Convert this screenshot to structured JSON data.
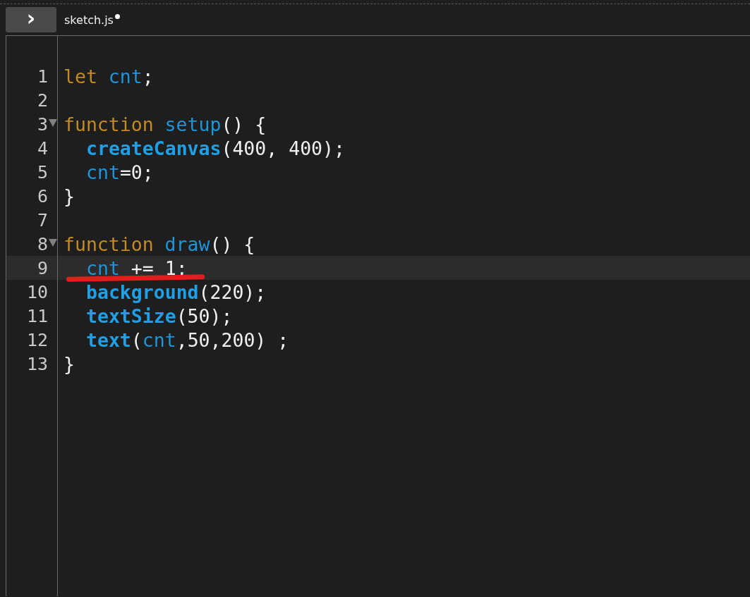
{
  "toolbar": {
    "toggle_button": {
      "label": "›"
    }
  },
  "tab": {
    "label": "sketch.js",
    "modified": true
  },
  "editor": {
    "lines": [
      {
        "number": "1",
        "fold": false,
        "current": false,
        "underlined": false,
        "indented": false,
        "tokens": [
          {
            "text": "let ",
            "kind": "keyword"
          },
          {
            "text": "cnt",
            "kind": "variable"
          },
          {
            "text": ";",
            "kind": "plain"
          }
        ]
      },
      {
        "number": "2",
        "fold": false,
        "current": false,
        "underlined": false,
        "indented": false
      },
      {
        "number": "3",
        "fold": true,
        "current": false,
        "underlined": false,
        "indented": false,
        "tokens": [
          {
            "text": "function ",
            "kind": "keyword"
          },
          {
            "text": "setup",
            "kind": "variable"
          },
          {
            "text": "() {",
            "kind": "plain"
          }
        ]
      },
      {
        "number": "4",
        "fold": false,
        "current": false,
        "underlined": false,
        "indented": true,
        "tokens": [
          {
            "text": "createCanvas",
            "kind": "builtin"
          },
          {
            "text": "(400, 400);",
            "kind": "plain"
          }
        ]
      },
      {
        "number": "5",
        "fold": false,
        "current": false,
        "underlined": false,
        "indented": true,
        "tokens": [
          {
            "text": "cnt",
            "kind": "variable"
          },
          {
            "text": "=0;",
            "kind": "plain"
          }
        ]
      },
      {
        "number": "6",
        "fold": false,
        "current": false,
        "underlined": false,
        "indented": false,
        "tokens": [
          {
            "text": "}",
            "kind": "plain"
          }
        ]
      },
      {
        "number": "7",
        "fold": false,
        "current": false,
        "underlined": false,
        "indented": false
      },
      {
        "number": "8",
        "fold": true,
        "current": false,
        "underlined": false,
        "indented": false,
        "tokens": [
          {
            "text": "function ",
            "kind": "keyword"
          },
          {
            "text": "draw",
            "kind": "variable"
          },
          {
            "text": "() {",
            "kind": "plain"
          }
        ]
      },
      {
        "number": "9",
        "fold": false,
        "current": true,
        "underlined": true,
        "indented": true,
        "tokens": [
          {
            "text": "cnt",
            "kind": "variable"
          },
          {
            "text": " += 1;",
            "kind": "plain"
          }
        ]
      },
      {
        "number": "10",
        "fold": false,
        "current": false,
        "underlined": false,
        "indented": true,
        "tokens": [
          {
            "text": "background",
            "kind": "builtin"
          },
          {
            "text": "(220);",
            "kind": "plain"
          }
        ]
      },
      {
        "number": "11",
        "fold": false,
        "current": false,
        "underlined": false,
        "indented": true,
        "tokens": [
          {
            "text": "textSize",
            "kind": "builtin"
          },
          {
            "text": "(50);",
            "kind": "plain"
          }
        ]
      },
      {
        "number": "12",
        "fold": false,
        "current": false,
        "underlined": false,
        "indented": true,
        "tokens": [
          {
            "text": "text",
            "kind": "builtin"
          },
          {
            "text": "(",
            "kind": "plain"
          },
          {
            "text": "cnt",
            "kind": "variable"
          },
          {
            "text": ",50,200) ;",
            "kind": "plain"
          }
        ]
      },
      {
        "number": "13",
        "fold": false,
        "current": false,
        "underlined": false,
        "indented": false,
        "tokens": [
          {
            "text": "}",
            "kind": "plain"
          }
        ]
      }
    ]
  }
}
